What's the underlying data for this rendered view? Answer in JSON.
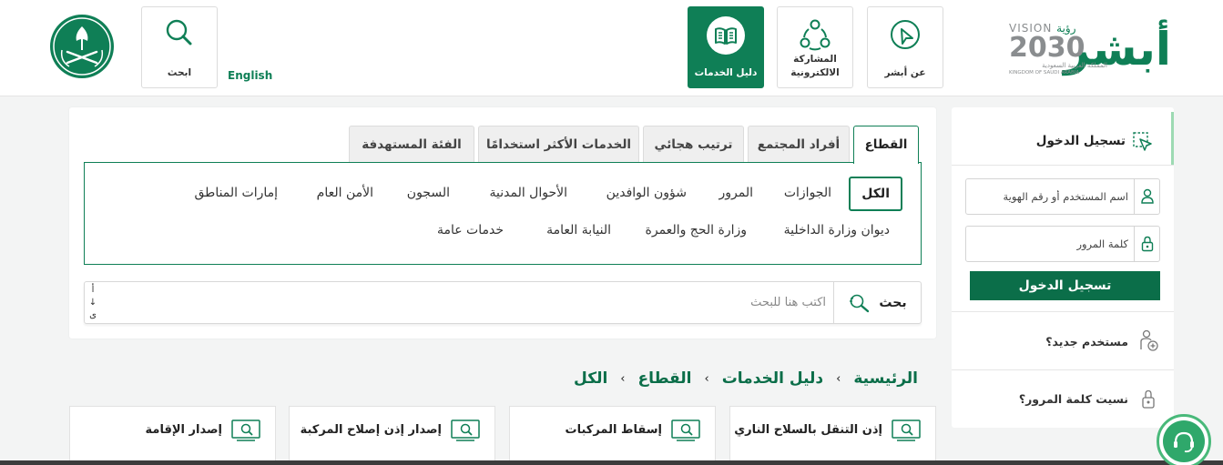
{
  "header": {
    "brand": {
      "absher_mark": "أبشر",
      "vision_word": "VISION",
      "vision_arabic": "رؤية",
      "vision_year": "2030",
      "kingdom_ar": "المملكة العربية السعودية",
      "kingdom_en": "KINGDOM OF SAUDI ARABIA"
    },
    "nav": [
      {
        "label": "عن أبشر",
        "icon": "pointer-arrow-icon"
      },
      {
        "label": "المشاركة الالكترونية",
        "icon": "participation-icon"
      },
      {
        "label": "دليل الخدمات",
        "icon": "book-icon",
        "active": true
      },
      {
        "label": "ابحث",
        "icon": "search-icon"
      }
    ],
    "language_link": "English",
    "emblem": "saudi-emblem-icon"
  },
  "catalog": {
    "tabs": [
      "القطاع",
      "أفراد المجتمع",
      "ترتيب هجائي",
      "الخدمات الأكثر استخدامًا",
      "الفئة المستهدفة"
    ],
    "active_tab": "القطاع",
    "sectors_row1": [
      "الكل",
      "الجوازات",
      "المرور",
      "شؤون الوافدين",
      "الأحوال المدنية",
      "السجون",
      "الأمن العام",
      "إمارات المناطق"
    ],
    "sectors_row2": [
      "ديوان وزارة الداخلية",
      "وزارة الحج والعمرة",
      "النيابة العامة",
      "خدمات عامة"
    ],
    "active_sector": "الكل",
    "search": {
      "button_label": "بحث",
      "placeholder": "اكتب هنا للبحث",
      "key_hint": [
        "أ",
        "↓",
        "ى"
      ]
    }
  },
  "breadcrumb": [
    "الرئيسية",
    "دليل الخدمات",
    "القطاع",
    "الكل"
  ],
  "breadcrumb_separator": "›",
  "services": [
    "إذن التنقل بالسلاح الناري",
    "إسقاط المركبات",
    "إصدار إذن إصلاح المركبة",
    "إصدار الإقامة"
  ],
  "login": {
    "title": "تسجيل الدخول",
    "username_placeholder": "اسم المستخدم أو رقم الهوية",
    "password_placeholder": "كلمة المرور",
    "submit_label": "تسجيل الدخول",
    "new_user": "مستخدم جديد؟",
    "forgot_password": "نسيت كلمة المرور؟"
  },
  "colors": {
    "brand_green": "#0f7f56",
    "brand_green_dark": "#0b6e49",
    "chat_green": "#2fa86b"
  }
}
